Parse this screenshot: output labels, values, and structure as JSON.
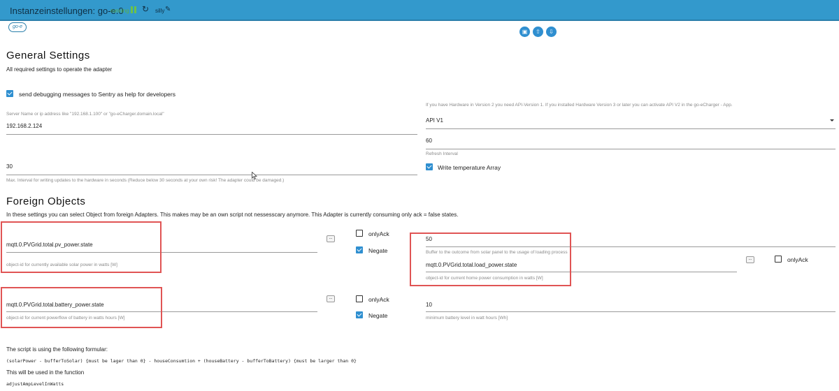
{
  "header": {
    "title": "Instanzeinstellungen: go-e.0",
    "status": "running",
    "loglevel": "silly"
  },
  "logo_text": "go-e",
  "general": {
    "heading": "General Settings",
    "subtitle": "All required settings to operate the adapter",
    "sentry_label": "send debugging messages to Sentry as help for developers",
    "server_help": "Server Name or ip address like \"192.168.1.100\" or \"go-eCharger.domain.local\"",
    "server_value": "192.168.2.124",
    "api_help": "If you have Hardware in Version 2 you need API-Version 1. If you installed Hardware Version 3 or later you can activate API V2 in the go-eCharger - App.",
    "api_value": "API V1",
    "refresh_value": "60",
    "refresh_help": "Refresh Interval",
    "write_interval_value": "30",
    "write_interval_help": "Max. Interval for writing updates to the hardware in seconds (Reduce below 30 seconds at your own risk! The adapter could be damaged.)",
    "temp_label": "Write temperature Array"
  },
  "foreign": {
    "heading": "Foreign Objects",
    "subtitle": "In these settings you can select Object from foreign Adapters. This makes may be an own script not nessesscary anymore. This Adapter is currently consuming only ack = false states.",
    "pv_value": "mqtt.0.PVGrid.total.pv_power.state",
    "pv_help": "object-id for currently available solar power in watts [W]",
    "dots": "...",
    "only_ack": "onlyAck",
    "negate": "Negate",
    "buffer_value": "50",
    "buffer_help": "Buffer to the outcome from solar panel to the usage of loading process",
    "load_value": "mqtt.0.PVGrid.total.load_power.state",
    "load_help": "object-id for current home power consumption in watts [W]",
    "battery_value": "mqtt.0.PVGrid.total.battery_power.state",
    "battery_help": "object-id for current powerflow of battery in watts hours [W]",
    "minbat_value": "10",
    "minbat_help": "minimum battery level in watt hours [Wh]"
  },
  "formula": {
    "intro": "The script is using the following formular:",
    "expression": "(solarPower - bufferToSolar) {must be lager than 0} - houseConsumtion + (houseBattery - bufferToBattery) {must be larger than 0}",
    "usage": "This will be used in the function",
    "function_name": "adjustAmpLevelInWatts"
  },
  "icons": {
    "reload": "↻",
    "pencil": "✎",
    "btn1": "▣",
    "btn2": "⇧",
    "btn3": "⇩"
  },
  "colors": {
    "header": "#3399cc",
    "accent": "#2f8fd0",
    "highlight": "#e05454"
  }
}
